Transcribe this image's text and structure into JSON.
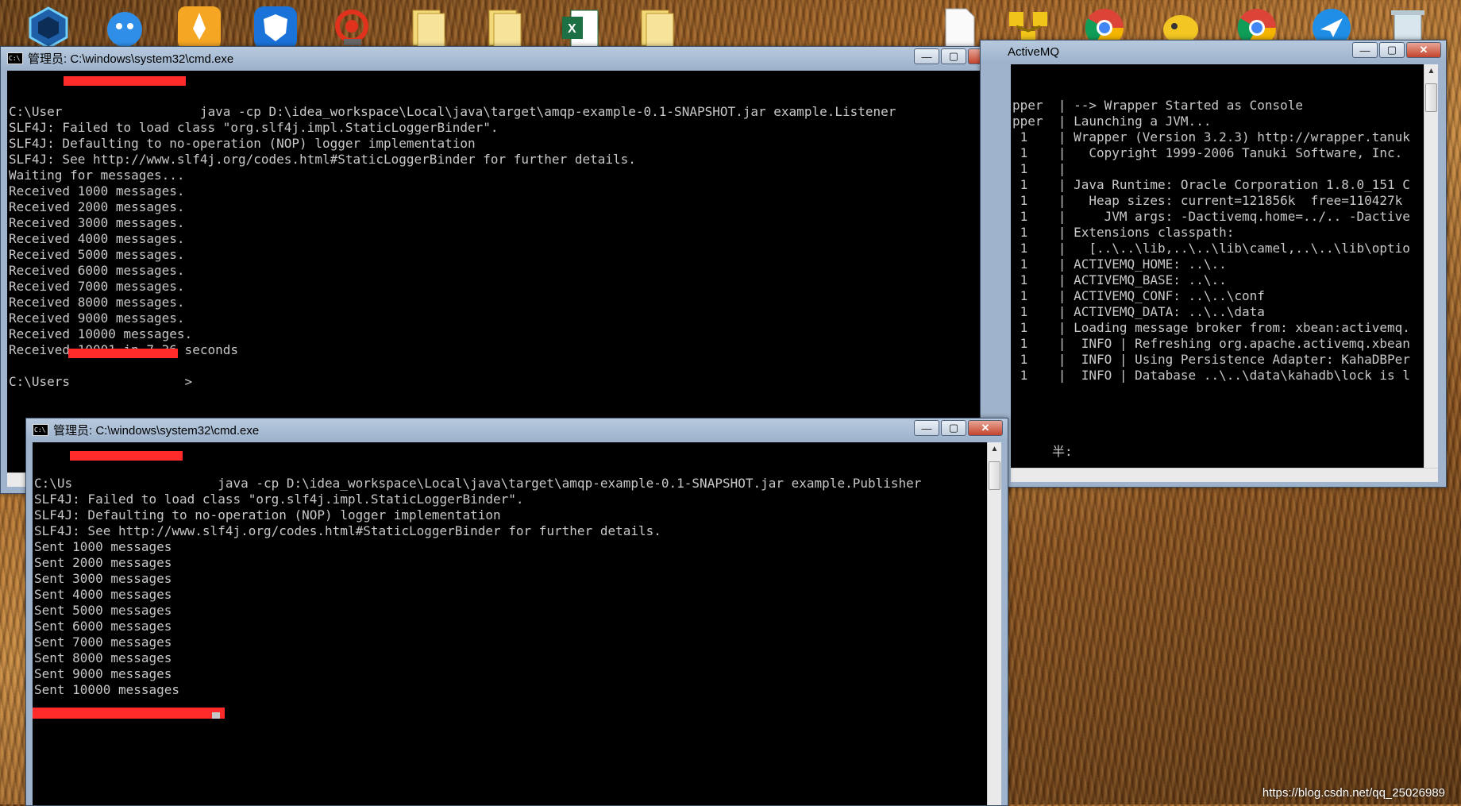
{
  "desktop": {
    "icons": [
      {
        "name": "hexagon-app-icon"
      },
      {
        "name": "qq-icon"
      },
      {
        "name": "rocket-app-icon"
      },
      {
        "name": "shield-app-icon"
      },
      {
        "name": "spiral-app-icon"
      },
      {
        "name": "folder-icon"
      },
      {
        "name": "folder-icon"
      },
      {
        "name": "excel-icon"
      },
      {
        "name": "folder-icon"
      },
      {
        "name": "document-icon"
      },
      {
        "name": "network-app-icon"
      },
      {
        "name": "chrome-icon"
      },
      {
        "name": "bird-app-icon"
      },
      {
        "name": "chrome-icon"
      },
      {
        "name": "feather-app-icon"
      },
      {
        "name": "recycle-bin-icon"
      }
    ],
    "watermark": "https://blog.csdn.net/qq_25026989"
  },
  "listener_window": {
    "title": "管理员: C:\\windows\\system32\\cmd.exe",
    "lines": [
      "C:\\User                  java -cp D:\\idea_workspace\\Local\\java\\target\\amqp-example-0.1-SNAPSHOT.jar example.Listener",
      "SLF4J: Failed to load class \"org.slf4j.impl.StaticLoggerBinder\".",
      "SLF4J: Defaulting to no-operation (NOP) logger implementation",
      "SLF4J: See http://www.slf4j.org/codes.html#StaticLoggerBinder for further details.",
      "Waiting for messages...",
      "Received 1000 messages.",
      "Received 2000 messages.",
      "Received 3000 messages.",
      "Received 4000 messages.",
      "Received 5000 messages.",
      "Received 6000 messages.",
      "Received 7000 messages.",
      "Received 8000 messages.",
      "Received 9000 messages.",
      "Received 10000 messages.",
      "Received 10001 in 7.36 seconds",
      "",
      "C:\\Users               >"
    ]
  },
  "activemq_window": {
    "title": "ActiveMQ",
    "lines": [
      "pper  | --> Wrapper Started as Console",
      "pper  | Launching a JVM...",
      " 1    | Wrapper (Version 3.2.3) http://wrapper.tanuk",
      " 1    |   Copyright 1999-2006 Tanuki Software, Inc.",
      " 1    |",
      " 1    | Java Runtime: Oracle Corporation 1.8.0_151 C",
      " 1    |   Heap sizes: current=121856k  free=110427k",
      " 1    |     JVM args: -Dactivemq.home=../.. -Dactive",
      " 1    | Extensions classpath:",
      " 1    |   [..\\..\\lib,..\\..\\lib\\camel,..\\..\\lib\\optio",
      " 1    | ACTIVEMQ_HOME: ..\\..",
      " 1    | ACTIVEMQ_BASE: ..\\..",
      " 1    | ACTIVEMQ_CONF: ..\\..\\conf",
      " 1    | ACTIVEMQ_DATA: ..\\..\\data",
      " 1    | Loading message broker from: xbean:activemq.",
      " 1    |  INFO | Refreshing org.apache.activemq.xbean",
      " 1    |  INFO | Using Persistence Adapter: KahaDBPer",
      " 1    |  INFO | Database ..\\..\\data\\kahadb\\lock is l"
    ],
    "ime_indicator": "半:"
  },
  "publisher_window": {
    "title": "管理员: C:\\windows\\system32\\cmd.exe",
    "lines": [
      "C:\\Us                   java -cp D:\\idea_workspace\\Local\\java\\target\\amqp-example-0.1-SNAPSHOT.jar example.Publisher",
      "SLF4J: Failed to load class \"org.slf4j.impl.StaticLoggerBinder\".",
      "SLF4J: Defaulting to no-operation (NOP) logger implementation",
      "SLF4J: See http://www.slf4j.org/codes.html#StaticLoggerBinder for further details.",
      "Sent 1000 messages",
      "Sent 2000 messages",
      "Sent 3000 messages",
      "Sent 4000 messages",
      "Sent 5000 messages",
      "Sent 6000 messages",
      "Sent 7000 messages",
      "Sent 8000 messages",
      "Sent 9000 messages",
      "Sent 10000 messages"
    ]
  },
  "controls": {
    "minimize": "—",
    "maximize": "▢",
    "close": "✕"
  }
}
